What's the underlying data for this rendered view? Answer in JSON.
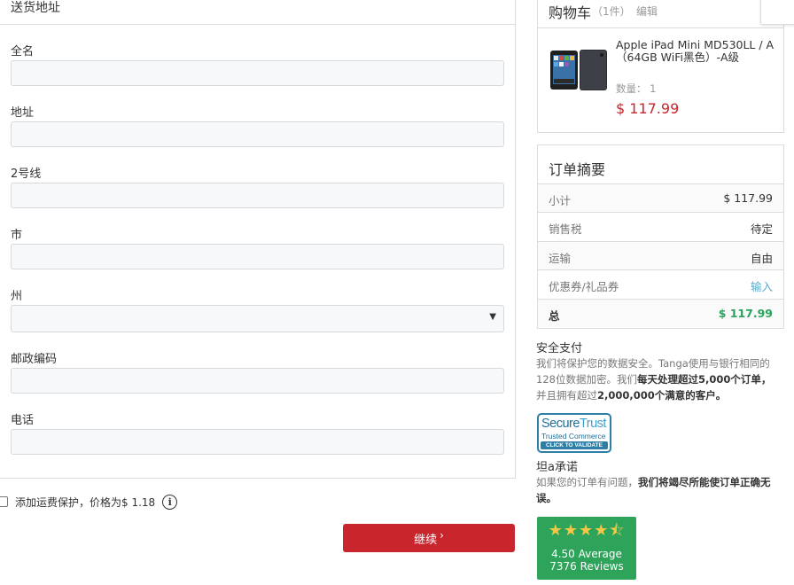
{
  "shipping": {
    "section_title": "送货地址",
    "fields": {
      "fullname": {
        "label": "全名",
        "value": ""
      },
      "address": {
        "label": "地址",
        "value": ""
      },
      "line2": {
        "label": "2号线",
        "value": ""
      },
      "city": {
        "label": "市",
        "value": ""
      },
      "state": {
        "label": "州",
        "value": ""
      },
      "zip": {
        "label": "邮政编码",
        "value": ""
      },
      "phone": {
        "label": "电话",
        "value": ""
      }
    },
    "protection_label": "添加运费保护，价格为$ 1.18",
    "info_icon": "i",
    "continue_label": "继续",
    "continue_chevron": "›"
  },
  "cart": {
    "title": "购物车",
    "count": "（1件）",
    "edit_label": "编辑",
    "item": {
      "name": "Apple iPad Mini MD530LL / A（64GB WiFi黑色）-A级",
      "qty_label": "数量：",
      "qty_value": "1",
      "price": "$ 117.99"
    }
  },
  "summary": {
    "title": "订单摘要",
    "rows": [
      {
        "label": "小计",
        "value": "$ 117.99"
      },
      {
        "label": "销售税",
        "value": "待定"
      },
      {
        "label": "运输",
        "value": "自由"
      },
      {
        "label": "优惠券/礼品券",
        "value": "输入"
      },
      {
        "label": "总",
        "value": "$ 117.99"
      }
    ]
  },
  "secure": {
    "title": "安全支付",
    "text_1": "我们将保护您的数据安全。Tanga使用与银行相同的128位数据加密。我们",
    "text_bold_1": "每天处理超过5,000个订单，",
    "text_2": "并且拥有超过",
    "text_bold_2": "2,000,000个满意的客户。",
    "badge_word_1": "Secure",
    "badge_word_2": "Trust",
    "badge_line_2": "Trusted Commerce",
    "badge_bar": "CLICK TO VALIDATE"
  },
  "promise": {
    "title": "坦a承诺",
    "text_1": "如果您的订单有问题，",
    "text_bold": "我们将竭尽所能使订单正确无误。"
  },
  "reviews": {
    "rating": 4.5,
    "average_text": "4.50 Average",
    "count_text": "7376 Reviews"
  },
  "colors": {
    "accent_red": "#c9252c",
    "total_green": "#27a35a",
    "link_blue": "#5aa9c9",
    "reviews_green": "#2ea35a"
  }
}
